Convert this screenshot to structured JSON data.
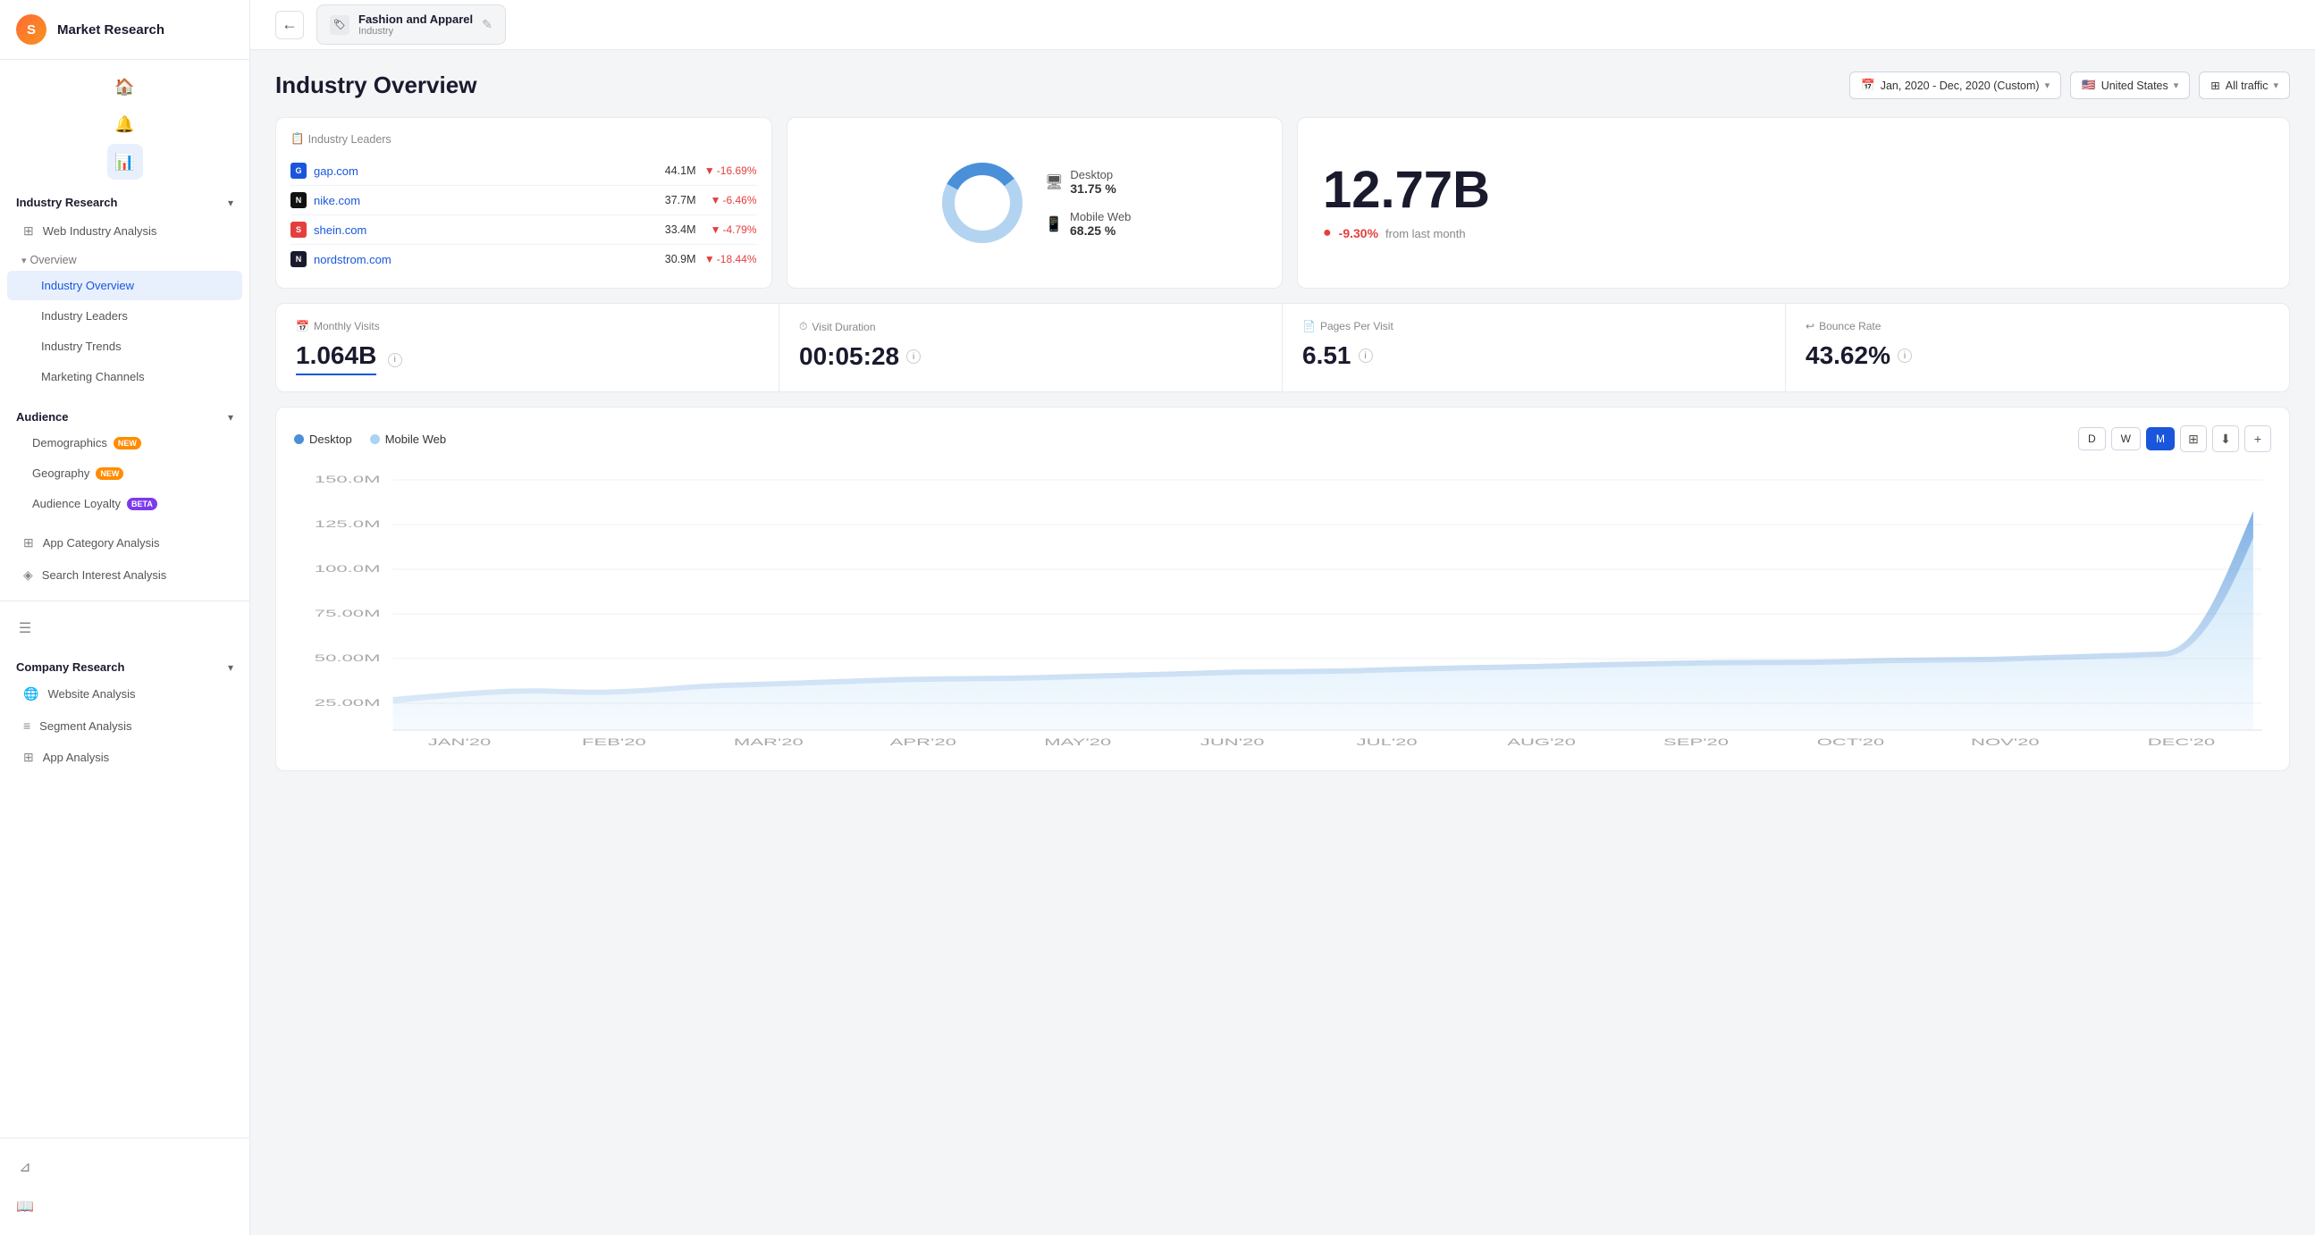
{
  "app": {
    "title": "Market Research",
    "logo_letter": "S"
  },
  "sidebar": {
    "sections": [
      {
        "label": "Industry Research",
        "expanded": true,
        "items": [
          {
            "id": "web-industry-analysis",
            "label": "Web Industry Analysis",
            "icon": "grid",
            "indent": false
          },
          {
            "id": "overview-group",
            "label": "Overview",
            "group": true
          },
          {
            "id": "industry-overview",
            "label": "Industry Overview",
            "active": true,
            "indent": true
          },
          {
            "id": "industry-leaders",
            "label": "Industry Leaders",
            "indent": true
          },
          {
            "id": "industry-trends",
            "label": "Industry Trends",
            "indent": true
          },
          {
            "id": "marketing-channels",
            "label": "Marketing Channels",
            "indent": true
          }
        ]
      },
      {
        "label": "Audience",
        "expanded": true,
        "items": [
          {
            "id": "demographics",
            "label": "Demographics",
            "badge": "NEW",
            "badge_type": "new"
          },
          {
            "id": "geography",
            "label": "Geography",
            "badge": "NEW",
            "badge_type": "new"
          },
          {
            "id": "audience-loyalty",
            "label": "Audience Loyalty",
            "badge": "BETA",
            "badge_type": "beta"
          }
        ]
      }
    ],
    "standalone_items": [
      {
        "id": "app-category-analysis",
        "label": "App Category Analysis",
        "icon": "grid"
      },
      {
        "id": "search-interest-analysis",
        "label": "Search Interest Analysis",
        "icon": "filter"
      }
    ],
    "company_research": {
      "label": "Company Research",
      "expanded": true,
      "items": [
        {
          "id": "website-analysis",
          "label": "Website Analysis",
          "icon": "globe"
        },
        {
          "id": "segment-analysis",
          "label": "Segment Analysis",
          "icon": "bars"
        },
        {
          "id": "app-analysis",
          "label": "App Analysis",
          "icon": "grid"
        }
      ]
    }
  },
  "topbar": {
    "back_title": "Fashion and Apparel",
    "back_subtitle": "Industry",
    "edit_tooltip": "Edit"
  },
  "page": {
    "title": "Industry Overview"
  },
  "filters": {
    "date_range": "Jan, 2020 - Dec, 2020 (Custom)",
    "country": "United States",
    "traffic": "All traffic",
    "date_icon": "📅",
    "flag": "🇺🇸"
  },
  "leaders_table": {
    "rows": [
      {
        "domain": "gap.com",
        "visits": "44.1M",
        "change": "-16.69%",
        "favicon_color": "#1a56db",
        "letter": "G"
      },
      {
        "domain": "nike.com",
        "visits": "37.7M",
        "change": "-6.46%",
        "favicon_color": "#111",
        "letter": "N"
      },
      {
        "domain": "shein.com",
        "visits": "33.4M",
        "change": "-4.79%",
        "favicon_color": "#e53e3e",
        "letter": "S"
      },
      {
        "domain": "nordstrom.com",
        "visits": "30.9M",
        "change": "-18.44%",
        "favicon_color": "#1a1a2e",
        "letter": "N"
      }
    ]
  },
  "device_split": {
    "desktop_pct": "31.75 %",
    "mobile_pct": "68.25 %",
    "desktop_label": "Desktop",
    "mobile_label": "Mobile Web",
    "desktop_color": "#4a90d9",
    "mobile_color": "#b3d4f0",
    "desktop_ratio": 31.75,
    "mobile_ratio": 68.25
  },
  "total_visits": {
    "value": "12.77B",
    "change": "-9.30%",
    "change_label": "from last month"
  },
  "metrics": [
    {
      "id": "monthly-visits",
      "label": "Monthly Visits",
      "value": "1.064B",
      "icon": "📅",
      "underlined": true
    },
    {
      "id": "visit-duration",
      "label": "Visit Duration",
      "value": "00:05:28",
      "icon": "⏱"
    },
    {
      "id": "pages-per-visit",
      "label": "Pages Per Visit",
      "value": "6.51",
      "icon": "📄"
    },
    {
      "id": "bounce-rate",
      "label": "Bounce Rate",
      "value": "43.62%",
      "icon": "↩"
    }
  ],
  "chart": {
    "legend": [
      {
        "label": "Desktop",
        "color": "#4a90d9"
      },
      {
        "label": "Mobile Web",
        "color": "#a8d4f5"
      }
    ],
    "controls": [
      "D",
      "W",
      "M"
    ],
    "active_control": "M",
    "y_labels": [
      "150.0M",
      "125.0M",
      "100.0M",
      "75.00M",
      "50.00M",
      "25.00M"
    ],
    "x_labels": [
      "JAN'20",
      "FEB'20",
      "MAR'20",
      "APR'20",
      "MAY'20",
      "JUN'20",
      "JUL'20",
      "AUG'20",
      "SEP'20",
      "OCT'20",
      "NOV'20",
      "DEC'20"
    ]
  },
  "icons": {
    "back_arrow": "←",
    "chevron_down": "▾",
    "chevron_right": "›",
    "info": "i",
    "home": "⌂",
    "chart": "📊",
    "globe": "🌐",
    "users": "👥",
    "star": "★",
    "grid": "⊞",
    "filter": "⌘",
    "book": "📖",
    "alert": "🔔",
    "edit": "✎",
    "excel": "⊞",
    "download": "⬇",
    "plus": "+",
    "down_arrow": "▼",
    "dropdown": "▾"
  }
}
